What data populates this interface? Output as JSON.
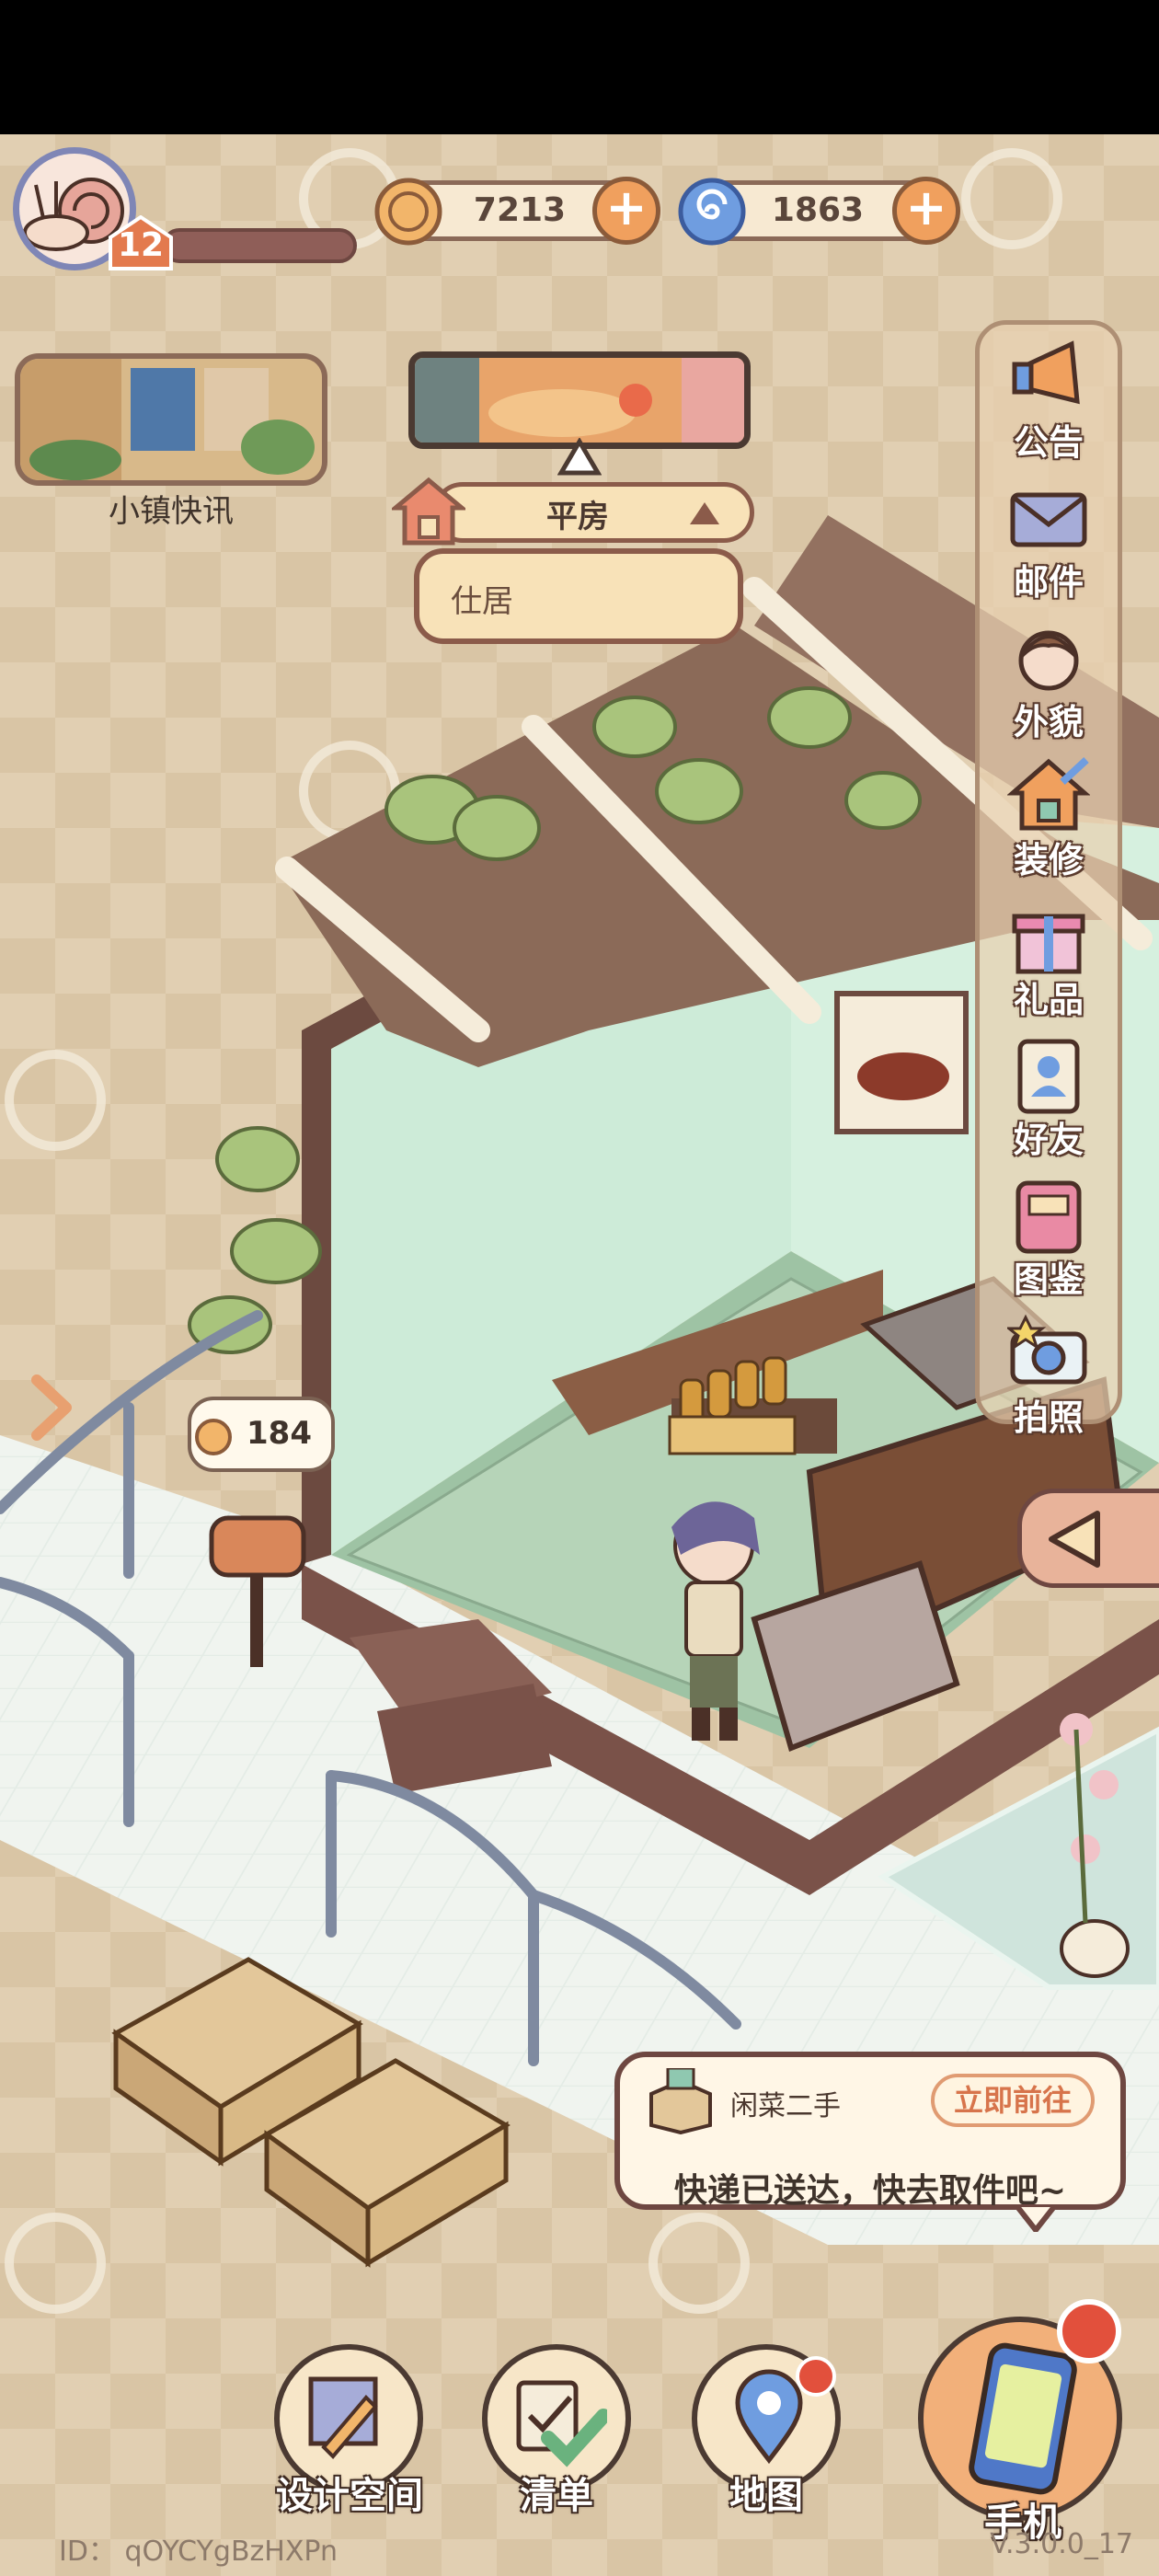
{
  "player": {
    "level": "12"
  },
  "resources": {
    "coins": "7213",
    "gems": "1863"
  },
  "news": {
    "label": "小镇快讯"
  },
  "building": {
    "current": "平房",
    "dropdown_option": "仕居"
  },
  "side_menu": [
    {
      "label": "公告",
      "icon": "announcement-icon"
    },
    {
      "label": "邮件",
      "icon": "mail-icon"
    },
    {
      "label": "外貌",
      "icon": "appearance-icon"
    },
    {
      "label": "装修",
      "icon": "renovate-icon"
    },
    {
      "label": "礼品",
      "icon": "gift-icon"
    },
    {
      "label": "好友",
      "icon": "friends-icon"
    },
    {
      "label": "图鉴",
      "icon": "collection-icon"
    },
    {
      "label": "拍照",
      "icon": "camera-icon"
    }
  ],
  "mailbox_bubble": {
    "value": "184"
  },
  "notification": {
    "sender": "闲菜二手",
    "action": "立即前往",
    "message": "快递已送达，快去取件吧~"
  },
  "bottom_bar": [
    {
      "label": "设计空间",
      "icon": "design-space-icon"
    },
    {
      "label": "清单",
      "icon": "checklist-icon"
    },
    {
      "label": "地图",
      "icon": "map-icon"
    },
    {
      "label": "手机",
      "icon": "phone-icon"
    }
  ],
  "footer": {
    "id": "ID： qOYCYgBzHXPn",
    "version": "V.3.0.0_17"
  },
  "colors": {
    "background": "#d8c3a2",
    "panel_border": "#8b6a58",
    "accent_orange": "#f0a05e",
    "wall_green": "#cdebd8"
  }
}
